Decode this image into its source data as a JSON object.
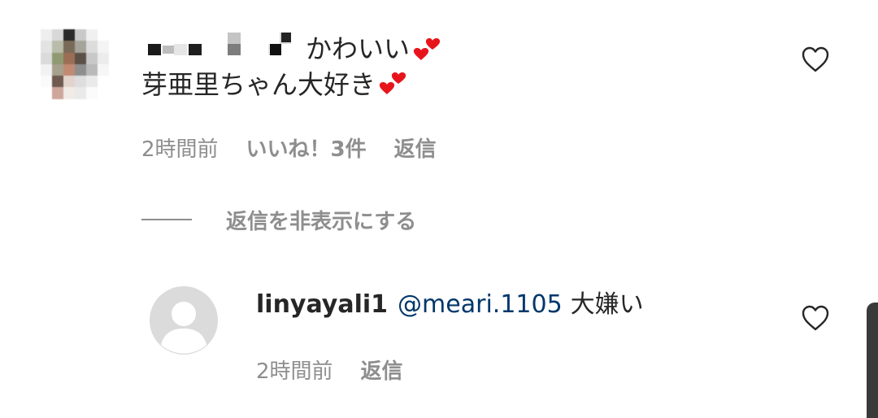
{
  "comment": {
    "username_redacted": true,
    "text_line1": "かわいい",
    "text_line2": "芽亜里ちゃん大好き",
    "emoji": "heart-pair",
    "time": "2時間前",
    "likes": "いいね！3件",
    "reply_label": "返信",
    "like_icon": "heart-outline-icon"
  },
  "replies_toggle": {
    "label": "返信を非表示にする"
  },
  "reply": {
    "username": "linyayali1",
    "mention": "@meari.1105",
    "text": "大嫌い",
    "time": "2時間前",
    "reply_label": "返信",
    "avatar": "default-avatar-icon",
    "like_icon": "heart-outline-icon"
  },
  "colors": {
    "meta_gray": "#8e8e8e",
    "mention_blue": "#00376b",
    "text_dark": "#262626",
    "emoji_red": "#e8141c"
  }
}
